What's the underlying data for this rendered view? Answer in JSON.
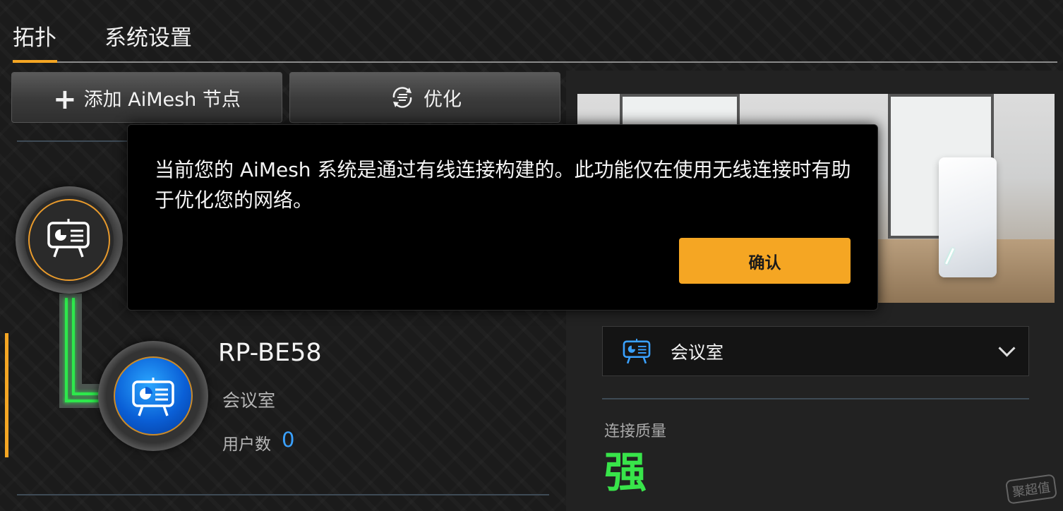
{
  "tabs": [
    {
      "label": "拓扑",
      "active": true
    },
    {
      "label": "系统设置",
      "active": false
    }
  ],
  "toolbar": {
    "add_label": "添加 AiMesh 节点",
    "add_icon": "plus-icon",
    "optimize_label": "优化",
    "optimize_icon": "optimize-cycle-icon"
  },
  "dialog": {
    "message": "当前您的 AiMesh 系统是通过有线连接构建的。此功能仅在使用无线连接时有助于优化您的网络。",
    "confirm_label": "确认"
  },
  "topology": {
    "router_icon": "meeting-room-icon",
    "node": {
      "name": "RP-BE58",
      "location": "会议室",
      "users_label": "用户数",
      "users_count": "0",
      "icon": "meeting-room-icon"
    }
  },
  "details": {
    "location_value": "会议室",
    "location_icon": "meeting-room-icon",
    "quality_label": "连接质量",
    "quality_value": "强"
  },
  "watermark": "聚超值",
  "colors": {
    "accent": "#f5a623",
    "good_signal": "#38e44a",
    "link_blue": "#3aa1ff"
  }
}
